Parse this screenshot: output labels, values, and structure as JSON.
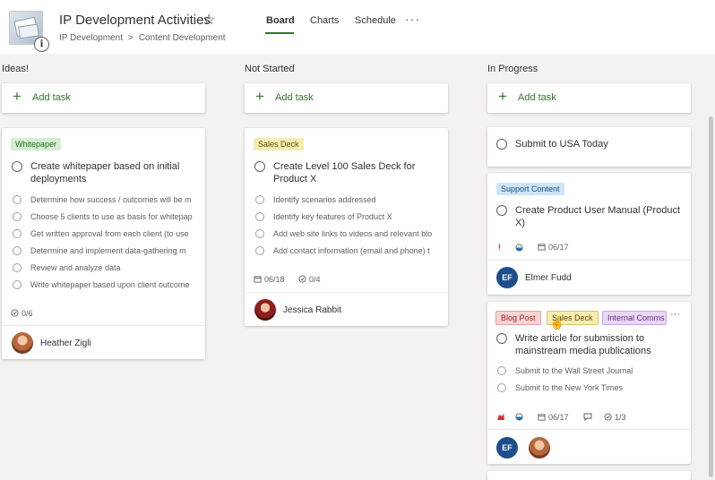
{
  "header": {
    "plan_title": "IP Development Activities",
    "breadcrumb": [
      "IP Development",
      "Content Development"
    ],
    "breadcrumb_separator": ">",
    "info_glyph": "i",
    "star_glyph": "☆",
    "more_glyph": "···",
    "tabs": [
      {
        "label": "Board",
        "active": true
      },
      {
        "label": "Charts",
        "active": false
      },
      {
        "label": "Schedule",
        "active": false
      }
    ]
  },
  "add_task_label": "Add task",
  "columns": [
    {
      "title": "Ideas!",
      "cards": [
        {
          "labels": [
            "Whitepaper"
          ],
          "title": "Create whitepaper based on initial deployments",
          "checklist": [
            "Determine how success / outcomes will be m",
            "Choose 5 clients to use as basis for whitepap",
            "Get written approval from each client (to use",
            "Determine and implement data-gathering m",
            "Review and analyze data",
            "Write whitepaper based upon client outcome"
          ],
          "checklist_progress": "0/6",
          "assignees": [
            "Heather Zigli"
          ]
        }
      ]
    },
    {
      "title": "Not Started",
      "cards": [
        {
          "labels": [
            "Sales Deck"
          ],
          "title": "Create Level 100 Sales Deck for Product X",
          "checklist": [
            "Identify scenarios addressed",
            "Identify key features of Product X",
            "Add web site links to videos and relevant blo",
            "Add contact information (email and phone) t"
          ],
          "due_date": "06/18",
          "checklist_progress": "0/4",
          "assignees": [
            "Jessica Rabbit"
          ]
        }
      ]
    },
    {
      "title": "In Progress",
      "cards": [
        {
          "title": "Submit to USA Today"
        },
        {
          "labels": [
            "Support Content"
          ],
          "title": "Create Product User Manual (Product X)",
          "priority_glyph": "!",
          "due_date": "06/17",
          "assignees": [
            "Elmer Fudd"
          ],
          "assignee_initials": "EF"
        },
        {
          "labels": [
            "Blog Post",
            "Sales Deck",
            "Internal Comms"
          ],
          "title": "Write article for submission to mainstream media publications",
          "checklist": [
            "Submit to the Wall Street Journal",
            "Submit to the New York Times"
          ],
          "due_date": "06/17",
          "checklist_progress": "1/3",
          "assignee_initials": "EF",
          "more_glyph": "···"
        }
      ]
    }
  ],
  "colors": {
    "accent_green": "#31752f",
    "background": "#f3f2f1",
    "avatar_blue": "#1d4e8c",
    "priority_red": "#d13438"
  },
  "icons": [
    "plan-thumbnail-icon",
    "info-icon",
    "favorite-star-icon",
    "more-icon",
    "plus-icon",
    "radio-circle-icon",
    "progress-check-icon",
    "calendar-icon",
    "progress-half-icon",
    "urgent-icon",
    "comment-icon",
    "cursor-icon"
  ]
}
